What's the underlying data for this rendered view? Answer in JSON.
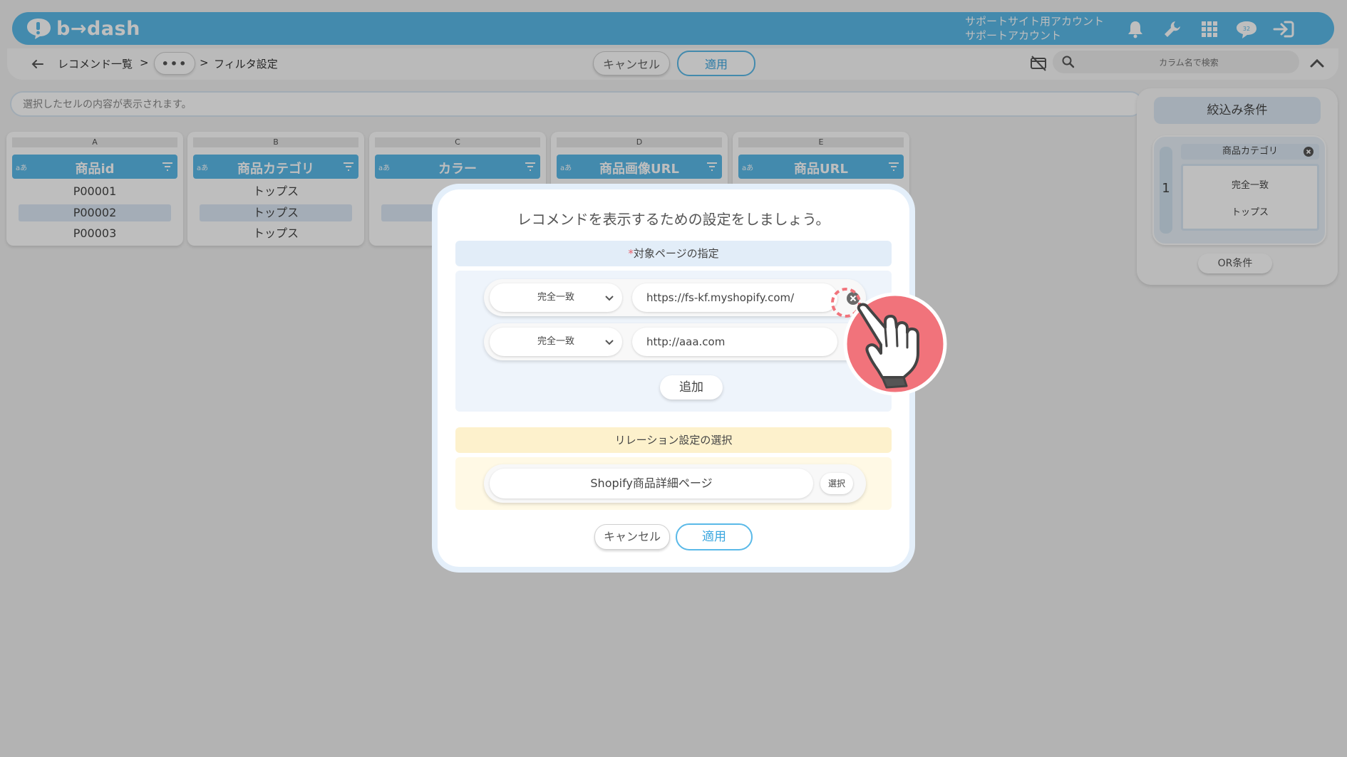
{
  "header": {
    "logo_text": "b→dash",
    "account_line1": "サポートサイト用アカウント",
    "account_line2": "サポートアカウント",
    "icons": [
      "bell-icon",
      "wrench-icon",
      "apps-grid-icon",
      "chat-badge-icon",
      "logout-icon"
    ],
    "chat_badge": "32"
  },
  "toolbar": {
    "back_icon": "arrow-left-icon",
    "crumb_list": "レコメンド一覧",
    "crumb_sep1": ">",
    "crumb_more": "•••",
    "crumb_sep2": ">",
    "crumb_current": "フィルタ設定",
    "cancel_label": "キャンセル",
    "apply_label": "適用",
    "search_placeholder": "カラム名で検索"
  },
  "cellbar": {
    "placeholder": "選択したセルの内容が表示されます。"
  },
  "columns": [
    {
      "letter": "A",
      "type": "aあ",
      "name": "商品id",
      "cells": [
        "P00001",
        "P00002",
        "P00003"
      ]
    },
    {
      "letter": "B",
      "type": "aあ",
      "name": "商品カテゴリ",
      "cells": [
        "トップス",
        "トップス",
        "トップス"
      ]
    },
    {
      "letter": "C",
      "type": "aあ",
      "name": "カラー",
      "cells": [
        "",
        "",
        ""
      ]
    },
    {
      "letter": "D",
      "type": "aあ",
      "name": "商品画像URL",
      "cells": [
        "",
        "",
        ""
      ]
    },
    {
      "letter": "E",
      "type": "aあ",
      "name": "商品URL",
      "cells": [
        "",
        "",
        ""
      ]
    }
  ],
  "filter_panel": {
    "title": "絞込み条件",
    "group_number": "1",
    "item_column": "商品カテゴリ",
    "item_operator": "完全一致",
    "item_value": "トップス",
    "or_label": "OR条件"
  },
  "modal": {
    "title": "レコメンドを表示するための設定をしましょう。",
    "target_required_mark": "*",
    "target_section": "対象ページの指定",
    "url_rules": [
      {
        "match": "完全一致",
        "url": "https://fs-kf.myshopify.com/"
      },
      {
        "match": "完全一致",
        "url": "http://aaa.com"
      }
    ],
    "add_label": "追加",
    "relation_section": "リレーション設定の選択",
    "relation_value": "Shopify商品詳細ページ",
    "relation_select_label": "選択",
    "cancel_label": "キャンセル",
    "apply_label": "適用"
  },
  "colors": {
    "accent": "#5ab9e8",
    "required": "#e8616c",
    "hand_pointer": "#f1737b"
  }
}
